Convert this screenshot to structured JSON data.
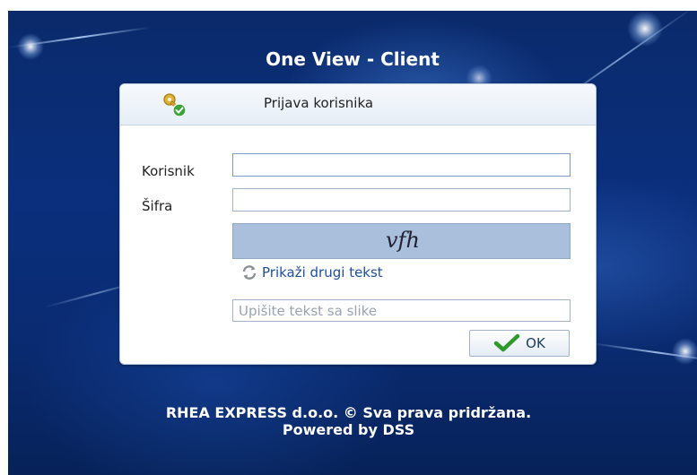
{
  "app": {
    "title": "One View - Client"
  },
  "login": {
    "header_title": "Prijava korisnika",
    "username_label": "Korisnik",
    "username_value": "",
    "password_label": "Šifra",
    "password_value": "",
    "captcha_text": "vfh",
    "refresh_label": "Prikaži drugi tekst",
    "captcha_input_placeholder": "Upišite tekst sa slike",
    "ok_label": "OK"
  },
  "footer": {
    "copyright": "RHEA EXPRESS d.o.o. © Sva prava pridržana.",
    "powered_by": "Powered by DSS"
  },
  "icons": {
    "header": "key-check-icon",
    "refresh": "refresh-icon",
    "ok": "checkmark-icon"
  },
  "colors": {
    "background": "#0b2f7d",
    "captcha_bg": "#a9bfdc",
    "link": "#1d4f9a",
    "checkmark": "#2f9a2a"
  }
}
